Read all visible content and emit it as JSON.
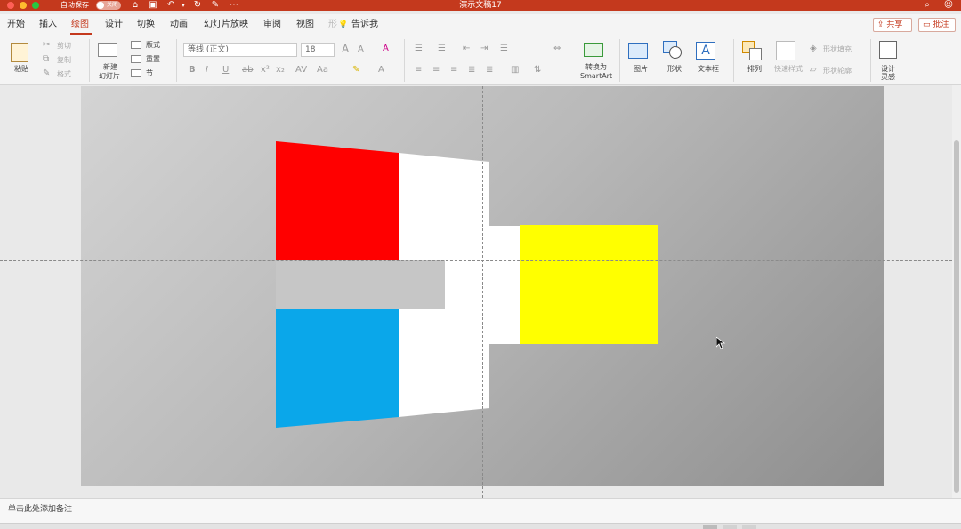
{
  "titlebar": {
    "autosave_label": "自动保存",
    "autosave_state": "关闭",
    "document_title": "演示文稿17"
  },
  "tabs": [
    {
      "label": "开始"
    },
    {
      "label": "插入"
    },
    {
      "label": "绘图",
      "active": true
    },
    {
      "label": "设计"
    },
    {
      "label": "切换"
    },
    {
      "label": "动画"
    },
    {
      "label": "幻灯片放映"
    },
    {
      "label": "审阅"
    },
    {
      "label": "视图"
    },
    {
      "label": "告诉我"
    }
  ],
  "tab_prefix": "形",
  "share_label": "共享",
  "comment_label": "批注",
  "ribbon": {
    "paste": "粘贴",
    "cut": "剪切",
    "copy": "复制",
    "format": "格式",
    "new_slide_line1": "新建",
    "new_slide_line2": "幻灯片",
    "layout": "版式",
    "reset": "重置",
    "section": "节",
    "font_name": "等线 (正文)",
    "font_size": "18",
    "convert_line1": "转换为",
    "convert_line2": "SmartArt",
    "picture": "图片",
    "shape": "形状",
    "textbox": "文本框",
    "arrange": "排列",
    "quick_styles": "快速样式",
    "shape_fill": "形状填充",
    "shape_outline": "形状轮廓",
    "designer_line1": "设计",
    "designer_line2": "灵感"
  },
  "notes_placeholder": "单击此处添加备注",
  "colors": {
    "accent": "#c4391d",
    "red_shape": "#ff0000",
    "blue_shape": "#0aa7ea",
    "yellow_shape": "#ffff00",
    "white_shape": "#ffffff",
    "light_gray_shape": "#c6c6c6"
  },
  "icons": [
    "home-icon",
    "save-icon",
    "undo-icon",
    "redo-icon",
    "edit-icon",
    "more-icon",
    "search-icon",
    "account-icon",
    "cursor-icon"
  ]
}
